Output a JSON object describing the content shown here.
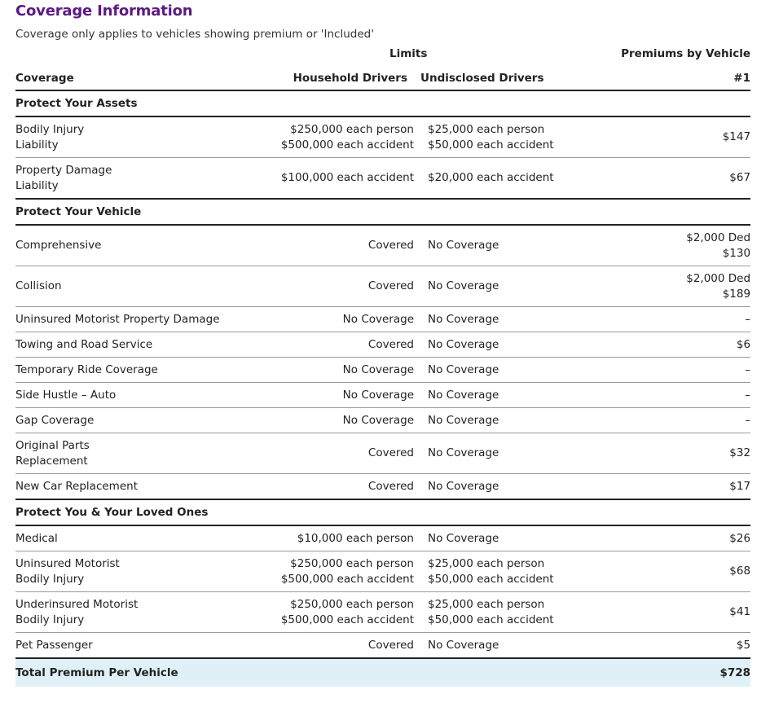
{
  "page": {
    "title": "Coverage Information",
    "subtitle": "Coverage only applies to vehicles showing premium or 'Included'"
  },
  "table_header": {
    "limits": "Limits",
    "premiums_by_vehicle": "Premiums by Vehicle",
    "coverage": "Coverage",
    "household_drivers": "Household Drivers",
    "undisclosed_drivers": "Undisclosed Drivers",
    "vehicle_number": "#1"
  },
  "sections": [
    {
      "title": "Protect Your Assets",
      "rows": [
        {
          "coverage": [
            "Bodily Injury",
            "Liability"
          ],
          "household": [
            "$250,000 each person",
            "$500,000 each accident"
          ],
          "undisclosed": [
            "$25,000 each person",
            "$50,000 each accident"
          ],
          "premium": [
            "$147"
          ]
        },
        {
          "coverage": [
            "Property Damage",
            "Liability"
          ],
          "household": [
            "$100,000 each accident"
          ],
          "undisclosed": [
            "$20,000 each accident"
          ],
          "premium": [
            "$67"
          ]
        }
      ]
    },
    {
      "title": "Protect Your Vehicle",
      "rows": [
        {
          "coverage": [
            "Comprehensive"
          ],
          "household": [
            "Covered"
          ],
          "undisclosed": [
            "No Coverage"
          ],
          "premium": [
            "$2,000 Ded",
            "$130"
          ]
        },
        {
          "coverage": [
            "Collision"
          ],
          "household": [
            "Covered"
          ],
          "undisclosed": [
            "No Coverage"
          ],
          "premium": [
            "$2,000 Ded",
            "$189"
          ]
        },
        {
          "coverage": [
            "Uninsured Motorist Property Damage"
          ],
          "household": [
            "No Coverage"
          ],
          "undisclosed": [
            "No Coverage"
          ],
          "premium": [
            "–"
          ]
        },
        {
          "coverage": [
            "Towing and Road Service"
          ],
          "household": [
            "Covered"
          ],
          "undisclosed": [
            "No Coverage"
          ],
          "premium": [
            "$6"
          ]
        },
        {
          "coverage": [
            "Temporary Ride Coverage"
          ],
          "household": [
            "No Coverage"
          ],
          "undisclosed": [
            "No Coverage"
          ],
          "premium": [
            "–"
          ]
        },
        {
          "coverage": [
            "Side Hustle – Auto"
          ],
          "household": [
            "No Coverage"
          ],
          "undisclosed": [
            "No Coverage"
          ],
          "premium": [
            "–"
          ]
        },
        {
          "coverage": [
            "Gap Coverage"
          ],
          "household": [
            "No Coverage"
          ],
          "undisclosed": [
            "No Coverage"
          ],
          "premium": [
            "–"
          ]
        },
        {
          "coverage": [
            "Original Parts",
            "Replacement"
          ],
          "household": [
            "Covered"
          ],
          "undisclosed": [
            "No Coverage"
          ],
          "premium": [
            "$32"
          ]
        },
        {
          "coverage": [
            "New Car Replacement"
          ],
          "household": [
            "Covered"
          ],
          "undisclosed": [
            "No Coverage"
          ],
          "premium": [
            "$17"
          ]
        }
      ]
    },
    {
      "title": "Protect You & Your Loved Ones",
      "rows": [
        {
          "coverage": [
            "Medical"
          ],
          "household": [
            "$10,000 each person"
          ],
          "undisclosed": [
            "No Coverage"
          ],
          "premium": [
            "$26"
          ]
        },
        {
          "coverage": [
            "Uninsured Motorist",
            "Bodily Injury"
          ],
          "household": [
            "$250,000 each person",
            "$500,000 each accident"
          ],
          "undisclosed": [
            "$25,000 each person",
            "$50,000 each accident"
          ],
          "premium": [
            "$68"
          ]
        },
        {
          "coverage": [
            "Underinsured Motorist",
            "Bodily Injury"
          ],
          "household": [
            "$250,000 each person",
            "$500,000 each accident"
          ],
          "undisclosed": [
            "$25,000 each person",
            "$50,000 each accident"
          ],
          "premium": [
            "$41"
          ]
        },
        {
          "coverage": [
            "Pet Passenger"
          ],
          "household": [
            "Covered"
          ],
          "undisclosed": [
            "No Coverage"
          ],
          "premium": [
            "$5"
          ]
        }
      ]
    }
  ],
  "total": {
    "label": "Total Premium Per Vehicle",
    "value": "$728"
  },
  "colors": {
    "title": "#5b1a84",
    "total_background": "#dff1f6"
  }
}
